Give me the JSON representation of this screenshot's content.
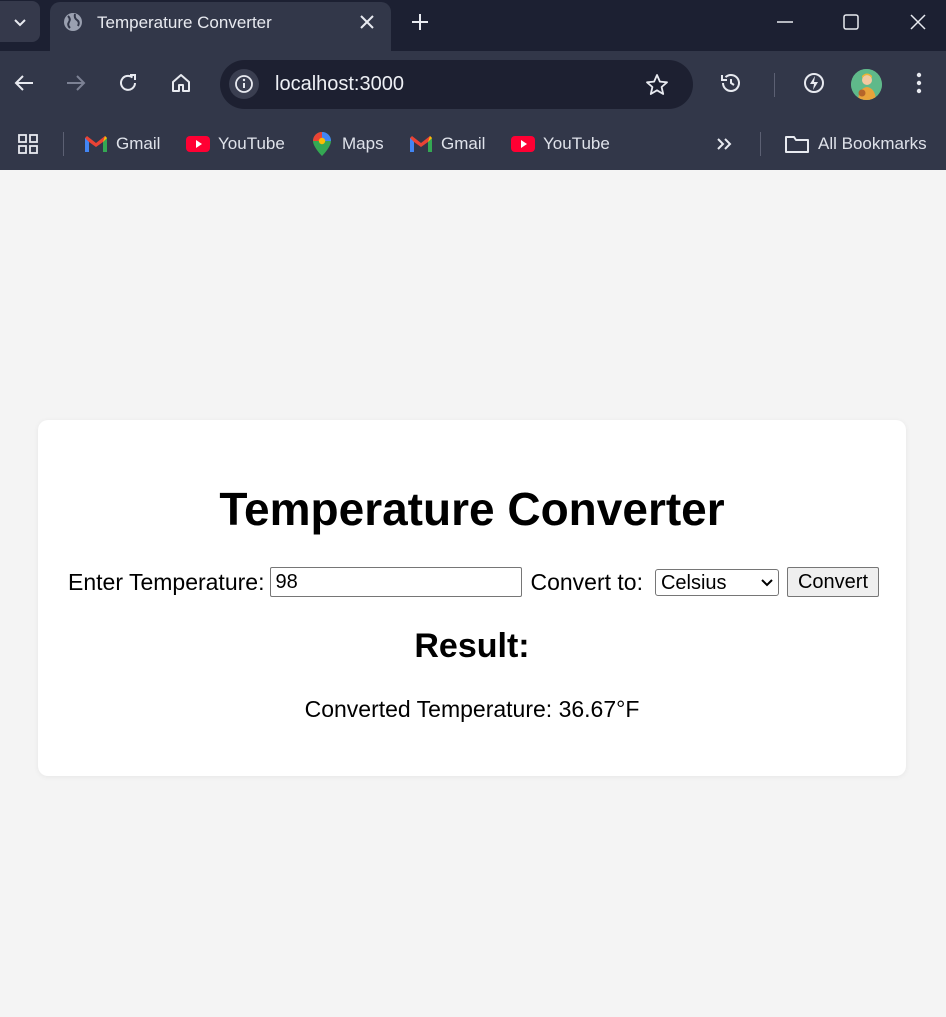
{
  "browser": {
    "tab_title": "Temperature Converter",
    "url": "localhost:3000",
    "bookmarks": [
      {
        "label": "Gmail",
        "icon": "gmail-icon"
      },
      {
        "label": "YouTube",
        "icon": "youtube-icon"
      },
      {
        "label": "Maps",
        "icon": "maps-icon"
      },
      {
        "label": "Gmail",
        "icon": "gmail-icon"
      },
      {
        "label": "YouTube",
        "icon": "youtube-icon"
      }
    ],
    "all_bookmarks_label": "All Bookmarks"
  },
  "page": {
    "title": "Temperature Converter",
    "input_label": "Enter Temperature:",
    "input_value": "98",
    "convert_to_label": "Convert to:",
    "selected_unit": "Celsius",
    "convert_button": "Convert",
    "result_heading": "Result:",
    "result_text": "Converted Temperature: 36.67°F"
  },
  "colors": {
    "tabstrip": "#1c2032",
    "toolbar": "#323749",
    "omnibox": "#1d2031",
    "page_background": "#f4f4f4",
    "card": "#ffffff"
  }
}
